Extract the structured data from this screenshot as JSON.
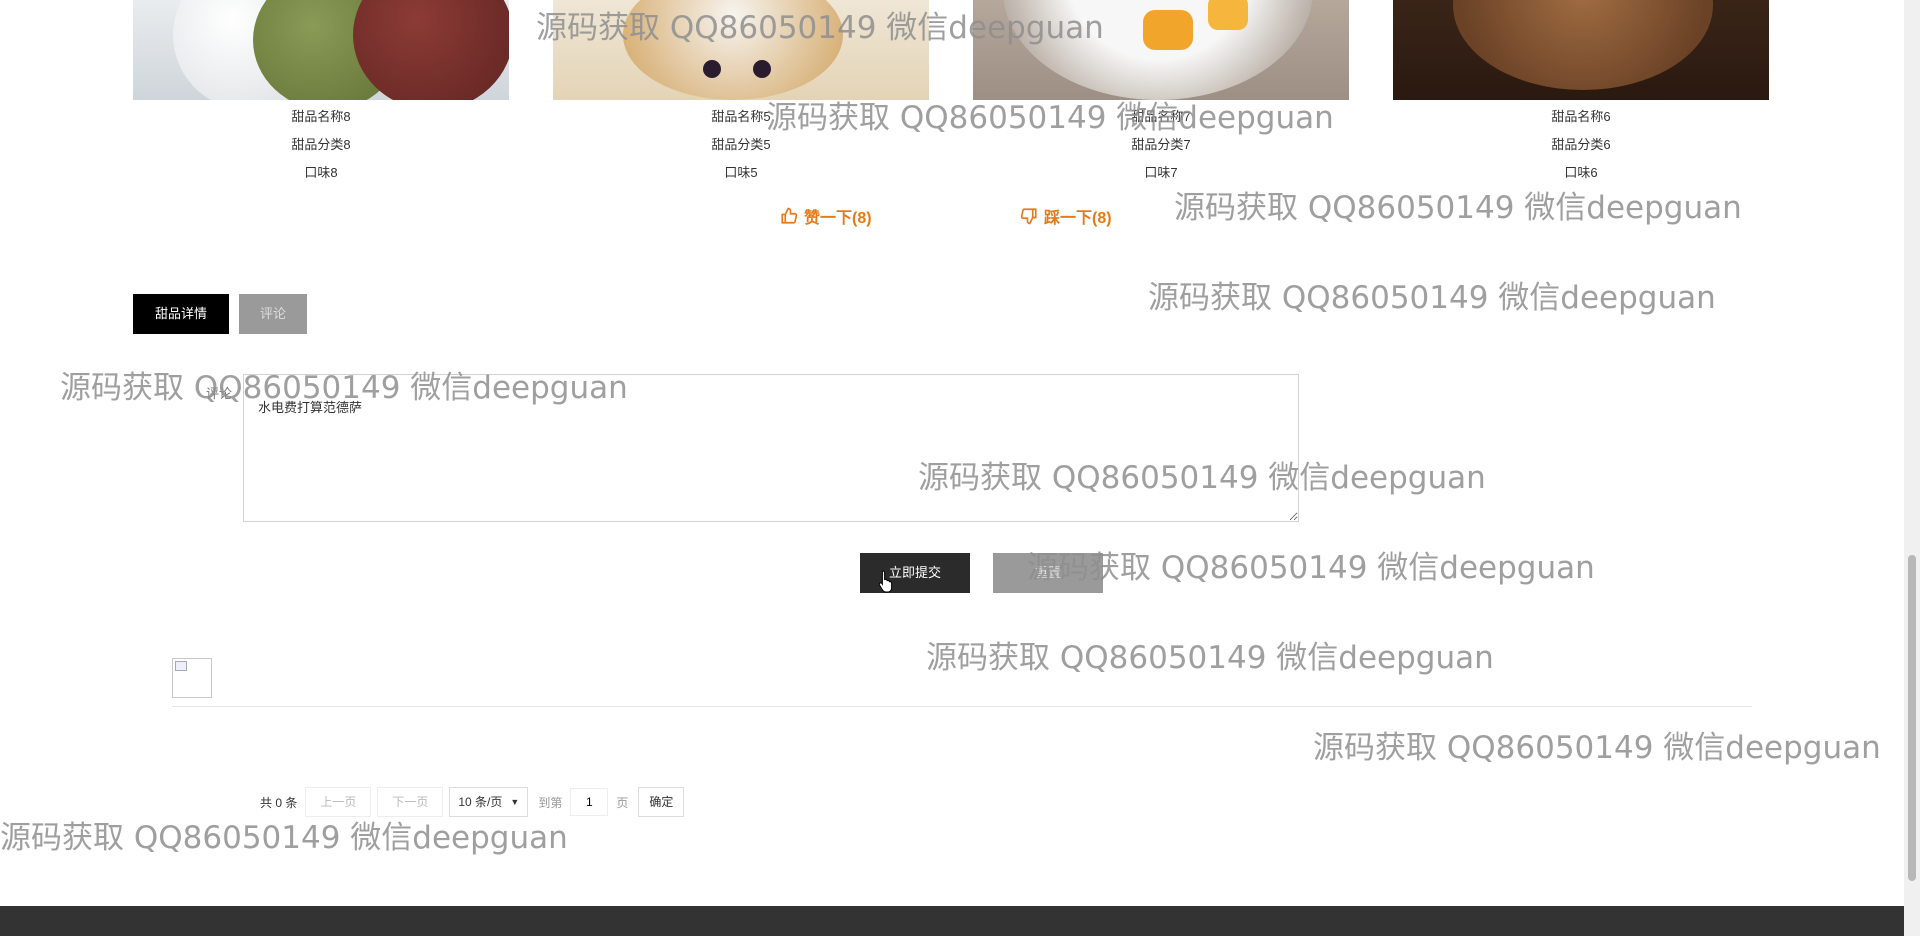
{
  "products": [
    {
      "name": "甜品名称8",
      "category": "甜品分类8",
      "flavor": "口味8"
    },
    {
      "name": "甜品名称5",
      "category": "甜品分类5",
      "flavor": "口味5"
    },
    {
      "name": "甜品名称7",
      "category": "甜品分类7",
      "flavor": "口味7"
    },
    {
      "name": "甜品名称6",
      "category": "甜品分类6",
      "flavor": "口味6"
    }
  ],
  "votes": {
    "like_label": "赞一下(8)",
    "dislike_label": "踩一下(8)",
    "like_icon": "thumbs-up-icon",
    "dislike_icon": "thumbs-down-icon",
    "accent": "#e77a16"
  },
  "tabs": [
    {
      "label": "甜品详情",
      "active": true
    },
    {
      "label": "评论",
      "active": false
    }
  ],
  "comment_form": {
    "label": "评论",
    "value": "水电费打算范德萨",
    "submit_label": "立即提交",
    "reset_label": "重置"
  },
  "pagination": {
    "total": "共 0 条",
    "prev": "上一页",
    "next": "下一页",
    "page_size": "10 条/页",
    "goto_label": "到第",
    "page_value": "1",
    "page_unit": "页",
    "confirm": "确定"
  },
  "watermark": {
    "text": "源码获取 QQ86050149 微信deepguan"
  }
}
